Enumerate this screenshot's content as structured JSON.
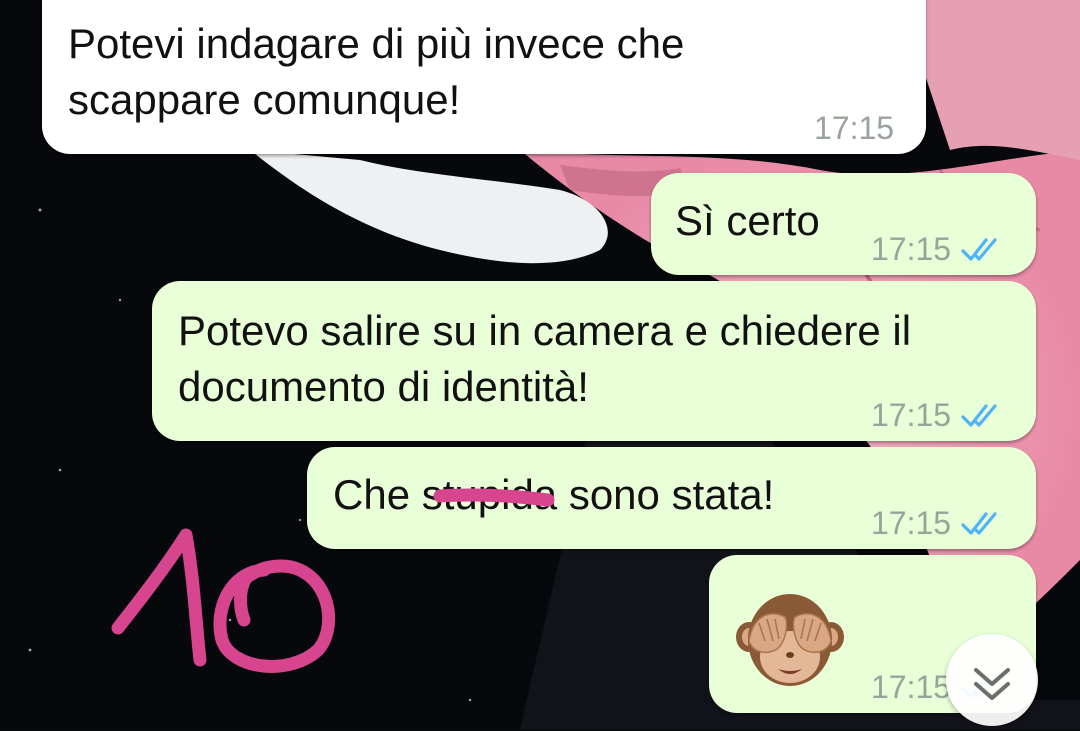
{
  "chat": {
    "messages": [
      {
        "direction": "incoming",
        "lines": [
          "Potevi indagare di più invece che",
          "scappare comunque!"
        ],
        "time": "17:15"
      },
      {
        "direction": "outgoing",
        "lines": [
          "Sì certo"
        ],
        "time": "17:15",
        "status": "read"
      },
      {
        "direction": "outgoing",
        "lines": [
          "Potevo salire su in camera e chiedere il",
          "documento di identità!"
        ],
        "time": "17:15",
        "status": "read"
      },
      {
        "direction": "outgoing",
        "text_before": "Che ",
        "struck": "stupi",
        "text_after": "da sono stata!",
        "time": "17:15",
        "status": "read"
      },
      {
        "direction": "outgoing",
        "emoji": "see-no-evil-monkey",
        "time": "17:15",
        "status": "read"
      }
    ]
  },
  "overlay": {
    "handwritten_number": "10",
    "ink_color": "#d6458e"
  },
  "colors": {
    "incoming_bubble": "#ffffff",
    "outgoing_bubble": "#e8ffd8",
    "read_ticks": "#4fb3f6",
    "timestamp": "#9aa39a"
  },
  "icons": {
    "scroll_button": "double-chevron-down-icon",
    "read_receipt": "double-check-icon"
  }
}
